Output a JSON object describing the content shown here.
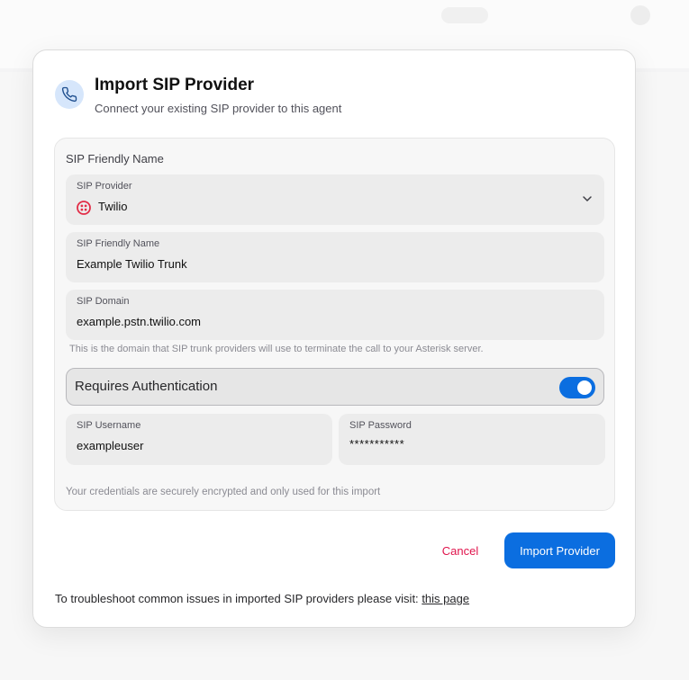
{
  "dialog": {
    "title": "Import SIP Provider",
    "subtitle": "Connect your existing SIP provider to this agent",
    "header_icon": "phone-icon"
  },
  "form": {
    "section_label": "SIP Friendly Name",
    "provider": {
      "label": "SIP Provider",
      "value": "Twilio",
      "icon": "twilio-logo",
      "dropdown_icon": "chevron-down-icon"
    },
    "friendly_name": {
      "label": "SIP Friendly Name",
      "value": "Example Twilio Trunk"
    },
    "domain": {
      "label": "SIP Domain",
      "value": "example.pstn.twilio.com",
      "help": "This is the domain that SIP trunk providers will use to terminate the call to your Asterisk server."
    },
    "auth": {
      "label": "Requires Authentication",
      "enabled": true
    },
    "username": {
      "label": "SIP Username",
      "value": "exampleuser"
    },
    "password": {
      "label": "SIP Password",
      "value": "***********"
    },
    "secure_note": "Your credentials are securely encrypted and only used for this import"
  },
  "actions": {
    "cancel_label": "Cancel",
    "import_label": "Import Provider"
  },
  "footer": {
    "text": "To troubleshoot common issues in imported SIP providers please visit:",
    "link_label": "this page"
  },
  "colors": {
    "accent": "#0b6ee0",
    "cancel": "#e0144c",
    "twilio": "#e22d47"
  }
}
